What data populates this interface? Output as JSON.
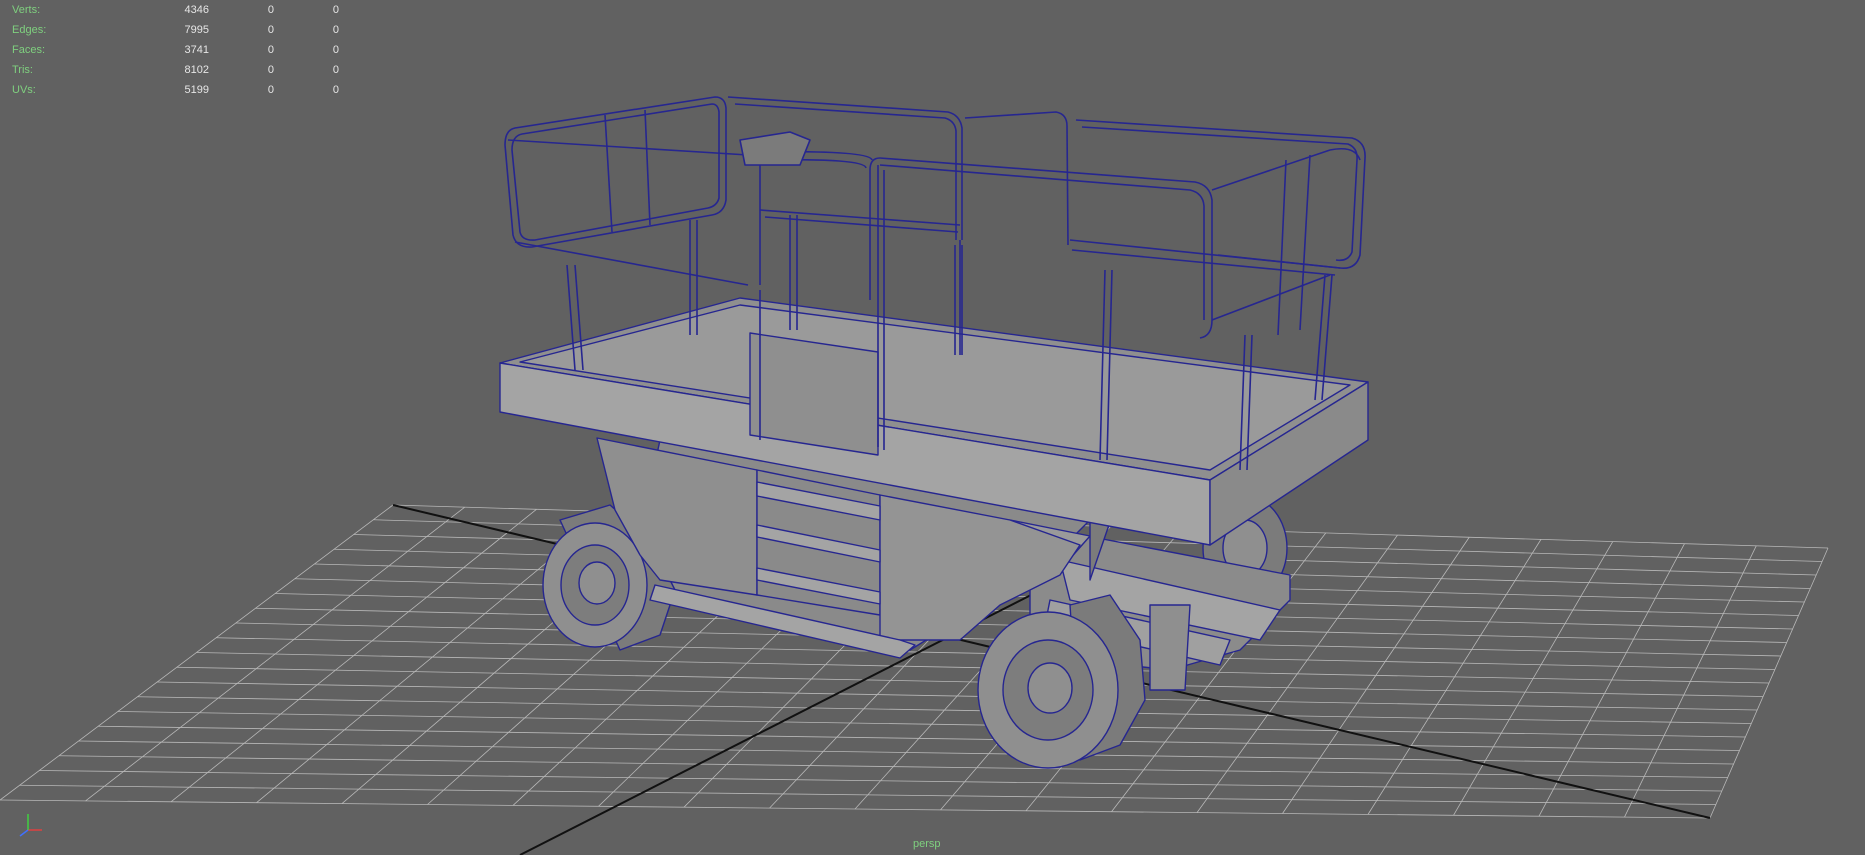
{
  "hud": {
    "rows": [
      {
        "label": "Verts:",
        "values": [
          "4346",
          "0",
          "0"
        ]
      },
      {
        "label": "Edges:",
        "values": [
          "7995",
          "0",
          "0"
        ]
      },
      {
        "label": "Faces:",
        "values": [
          "3741",
          "0",
          "0"
        ]
      },
      {
        "label": "Tris:",
        "values": [
          "8102",
          "0",
          "0"
        ]
      },
      {
        "label": "UVs:",
        "values": [
          "5199",
          "0",
          "0"
        ]
      }
    ]
  },
  "viewport": {
    "camera": "persp",
    "background_color": "#616161",
    "grid_color": "#b8b8b8",
    "axis_line_color": "#111111",
    "wire_color": "#262690",
    "model_fill": "#8f8f8f",
    "model_fill_dark": "#7b7b7b",
    "model_fill_light": "#a4a4a4"
  },
  "gizmo": {
    "x_color": "#e04040",
    "y_color": "#40d040",
    "z_color": "#4070ff"
  }
}
